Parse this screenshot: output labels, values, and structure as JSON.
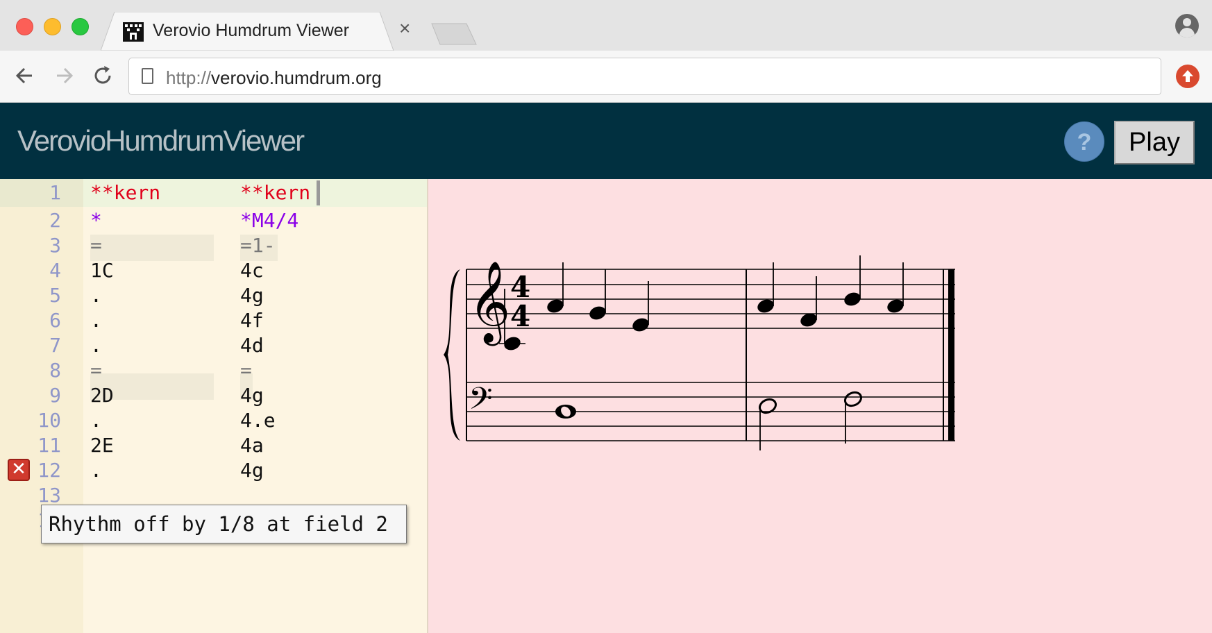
{
  "browser": {
    "tab_title": "Verovio Humdrum Viewer",
    "tab_close": "×",
    "url_scheme": "http://",
    "url_host": "verovio.humdrum.org"
  },
  "app": {
    "title": "VerovioHumdrumViewer",
    "help_label": "?",
    "play_label": "Play"
  },
  "editor": {
    "lines": [
      {
        "n": "1",
        "c1": "**kern",
        "c2": "**kern"
      },
      {
        "n": "2",
        "c1": "*",
        "c2": "*M4/4"
      },
      {
        "n": "3",
        "c1": "=",
        "c2": "=1-"
      },
      {
        "n": "4",
        "c1": "1C",
        "c2": "4c"
      },
      {
        "n": "5",
        "c1": ".",
        "c2": "4g"
      },
      {
        "n": "6",
        "c1": ".",
        "c2": "4f"
      },
      {
        "n": "7",
        "c1": ".",
        "c2": "4d"
      },
      {
        "n": "8",
        "c1": "=",
        "c2": "="
      },
      {
        "n": "9",
        "c1": "2D",
        "c2": "4g"
      },
      {
        "n": "10",
        "c1": ".",
        "c2": "4.e"
      },
      {
        "n": "11",
        "c1": "2E",
        "c2": "4a"
      },
      {
        "n": "12",
        "c1": ".",
        "c2": "4g"
      },
      {
        "n": "13",
        "c1": "",
        "c2": ""
      },
      {
        "n": "14",
        "c1": "*-",
        "c2": "*-"
      }
    ],
    "error_line": "11",
    "error_marker": "✕",
    "tooltip": "Rhythm off by 1/8 at field 2"
  },
  "notation": {
    "time_signature": "4/4",
    "treble_clef": "𝄞",
    "bass_clef": "𝄢"
  },
  "colors": {
    "header_bg": "#013040",
    "editor_bg": "#fdf5e2",
    "notation_bg": "#fddfe1",
    "exclusive_interp": "#e0001a",
    "interpretation": "#8a00e8"
  }
}
